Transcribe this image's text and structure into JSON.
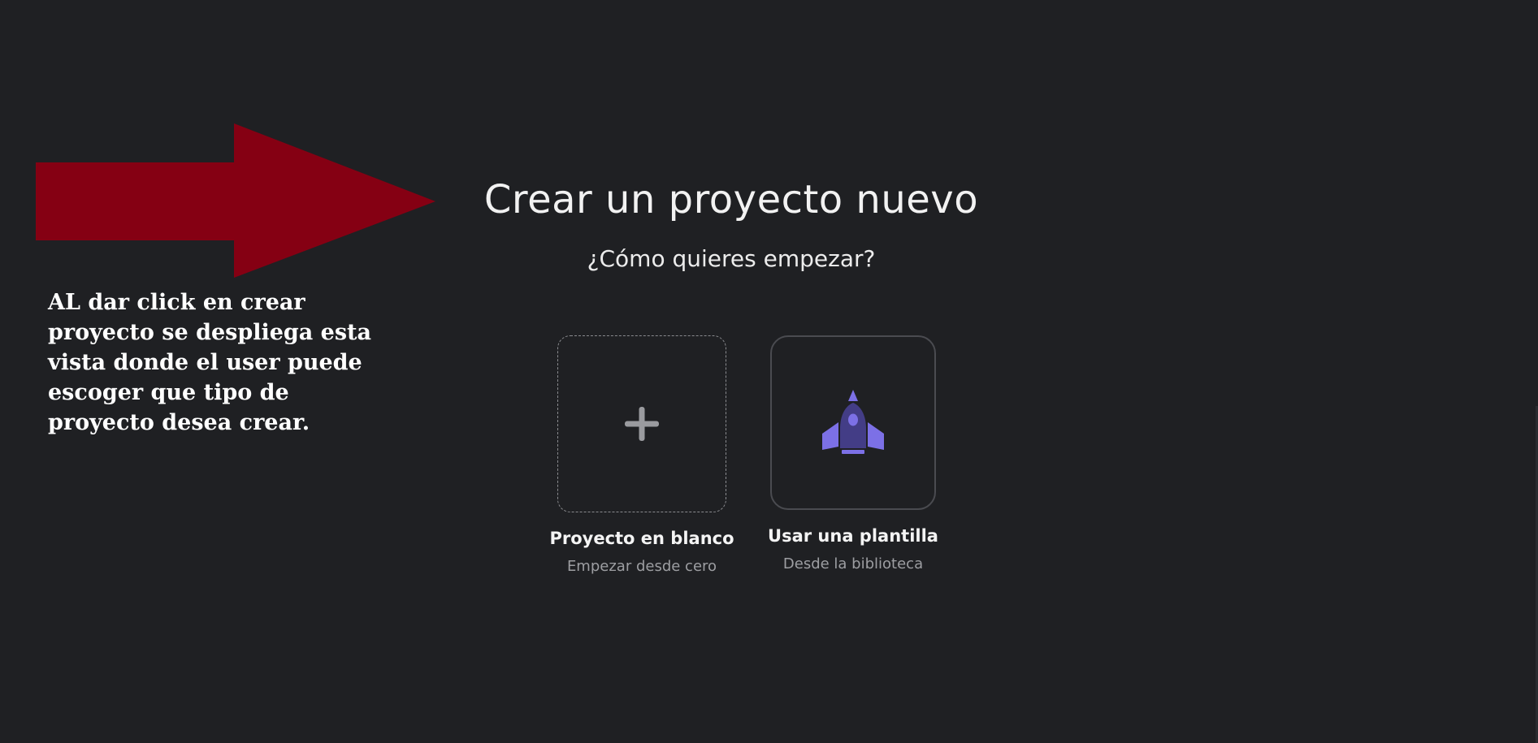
{
  "annotation": {
    "note": "AL dar click  en crear proyecto se despliega esta vista donde el user puede escoger que tipo de proyecto desea crear.",
    "arrow_color": "#850013"
  },
  "dialog": {
    "title": "Crear un proyecto nuevo",
    "subtitle": "¿Cómo quieres empezar?",
    "options": [
      {
        "icon": "plus-icon",
        "label": "Proyecto en blanco",
        "sublabel": "Empezar desde cero"
      },
      {
        "icon": "rocket-icon",
        "label": "Usar una plantilla",
        "sublabel": "Desde la biblioteca"
      }
    ]
  },
  "colors": {
    "background": "#1f2023",
    "accent": "#7c70e6",
    "plus": "#9a9b9f"
  }
}
